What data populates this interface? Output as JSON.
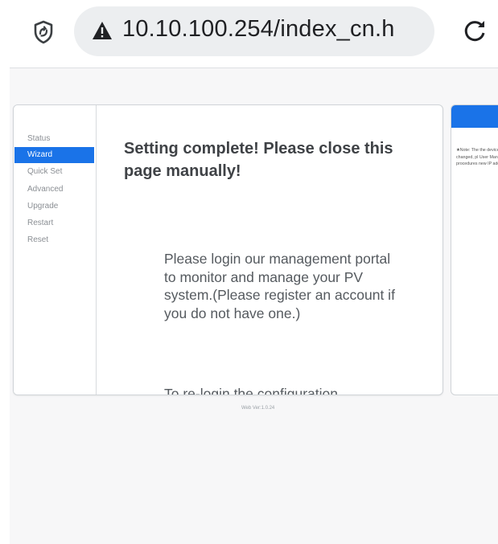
{
  "browser": {
    "url": "10.10.100.254/index_cn.h",
    "icons": {
      "security": "shield-icon",
      "warning": "warning-triangle-icon",
      "reload": "reload-icon"
    }
  },
  "sidebar": {
    "items": [
      {
        "label": "Status",
        "active": false
      },
      {
        "label": "Wizard",
        "active": true
      },
      {
        "label": "Quick Set",
        "active": false
      },
      {
        "label": "Advanced",
        "active": false
      },
      {
        "label": "Upgrade",
        "active": false
      },
      {
        "label": "Restart",
        "active": false
      },
      {
        "label": "Reset",
        "active": false
      }
    ]
  },
  "main": {
    "title": "Setting complete! Please close this page manually!",
    "message": "Please login our management portal to monitor and manage your PV system.(Please register an account if you do not have one.)",
    "message2": "To re-login the configuration"
  },
  "side_panel": {
    "note": "★Note: The the device c changed, pl User Manua procedures new IP addr"
  },
  "footer": {
    "version": "Web Ver:1.0.24"
  },
  "colors": {
    "accent": "#1a73e8",
    "page_bg": "#f7f7f8",
    "url_pill": "#eceef0"
  }
}
